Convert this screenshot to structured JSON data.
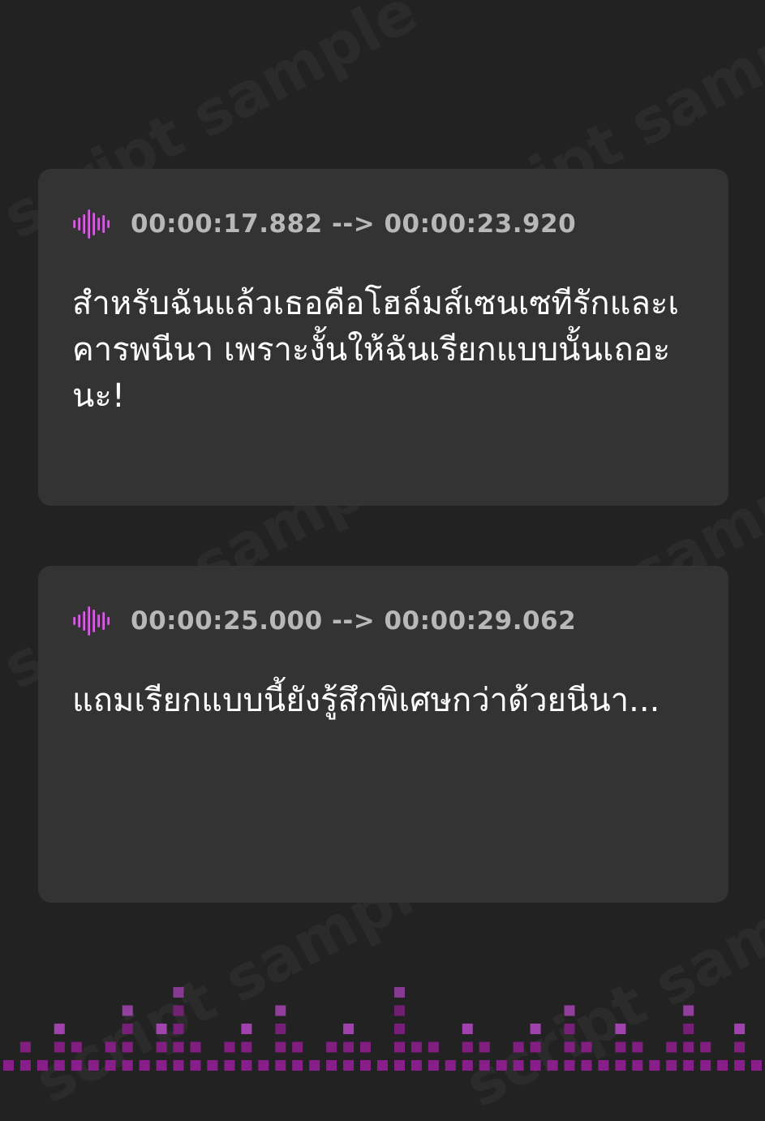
{
  "watermark": {
    "text": "script sample"
  },
  "colors": {
    "background": "#222222",
    "card": "#333333",
    "timecode": "#b8b8b8",
    "subtitle": "#ffffff",
    "accent": "#8e1f8f",
    "accent_bright": "#c14bd1"
  },
  "cues": [
    {
      "icon": "audio-waveform-icon",
      "timecode": "00:00:17.882 --> 00:00:23.920",
      "text": "สำหรับฉันแล้วเธอคือโฮล์มส์เซนเซทีรักและเคารพนีนา เพราะงั้นให้ฉันเรียกแบบนั้นเถอะนะ!"
    },
    {
      "icon": "audio-waveform-icon",
      "timecode": "00:00:25.000 --> 00:00:29.062",
      "text": "แถมเรียกแบบนี้ยังรู้สึกพิเศษกว่าด้วยนีนา..."
    }
  ],
  "equalizer": {
    "icon": "equalizer-bars-decoration",
    "levels": [
      1,
      2,
      1,
      3,
      2,
      1,
      2,
      4,
      1,
      3,
      5,
      2,
      1,
      2,
      3,
      1,
      4,
      2,
      1,
      2,
      3,
      2,
      1,
      5,
      2,
      2,
      1,
      3,
      2,
      1,
      2,
      3,
      1,
      4,
      2,
      1,
      3,
      2,
      1,
      2,
      4,
      2,
      1,
      3,
      1
    ]
  }
}
